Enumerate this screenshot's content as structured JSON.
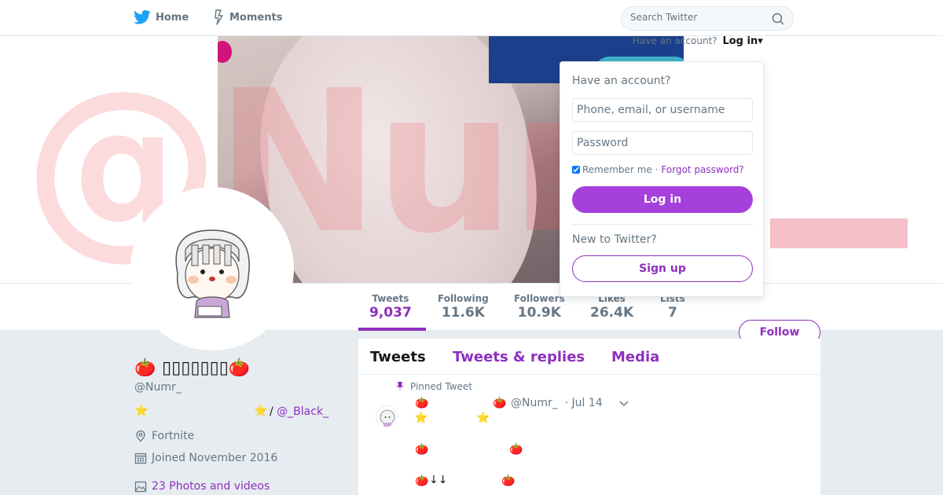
{
  "nav": {
    "home_label": "Home",
    "moments_label": "Moments",
    "search_placeholder": "Search Twitter"
  },
  "banner": {
    "watermark_text": "@Num"
  },
  "profile": {
    "name": "🍅 ▯▯▯▯▯▯▯🍅",
    "handle": "@Numr_",
    "bio_star": "⭐",
    "bio_slash": "/ ",
    "bio_link": "@_Black_",
    "location": "Fortnite",
    "joined": "Joined November 2016",
    "photos": "23 Photos and videos",
    "follow_label": "Follow"
  },
  "stats": [
    {
      "label": "Tweets",
      "value": "9,037"
    },
    {
      "label": "Following",
      "value": "11.6K"
    },
    {
      "label": "Followers",
      "value": "10.9K"
    },
    {
      "label": "Likes",
      "value": "26.4K"
    },
    {
      "label": "Lists",
      "value": "7"
    }
  ],
  "timeline": {
    "tabs": [
      "Tweets",
      "Tweets & replies",
      "Media"
    ],
    "pinned_label": "Pinned Tweet",
    "tweet_handle": "@Numr_",
    "tweet_date": "· Jul 14",
    "tomato": "🍅",
    "star": "⭐",
    "arrows": "↓↓"
  },
  "login": {
    "prompt": "Have an account?",
    "link": "Log in",
    "caret": "▾",
    "title": "Have an account?",
    "user_placeholder": "Phone, email, or username",
    "pass_placeholder": "Password",
    "remember": "Remember me",
    "separator": "·",
    "forgot": "Forgot password?",
    "login_button": "Log in",
    "new_prompt": "New to Twitter?",
    "signup_button": "Sign up"
  },
  "colors": {
    "accent": "#8e2fbf",
    "button": "#a540dc",
    "twitter_blue": "#1da1f2"
  }
}
